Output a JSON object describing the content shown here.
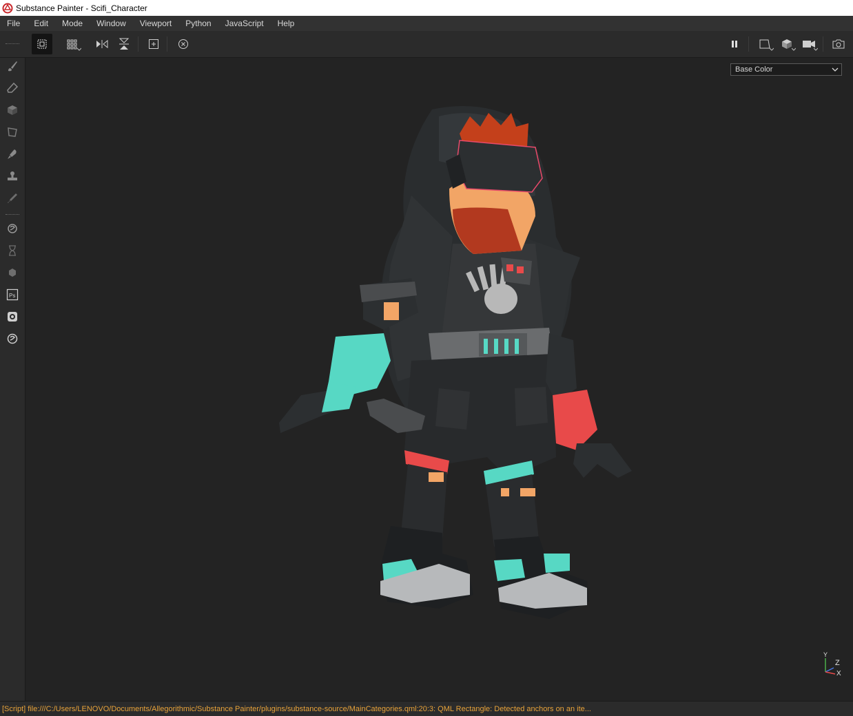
{
  "window": {
    "title": "Substance Painter - Scifi_Character",
    "logo_icon": "substance-painter-logo-icon"
  },
  "menu": {
    "items": [
      "File",
      "Edit",
      "Mode",
      "Window",
      "Viewport",
      "Python",
      "JavaScript",
      "Help"
    ]
  },
  "toolbar": {
    "left_icons": [
      "uv-select-icon",
      "grid-icon",
      "mirror-x-icon",
      "mirror-y-icon",
      "fit-view-icon",
      "reset-camera-icon"
    ],
    "right_icons": [
      "pause-icon",
      "viewport-2d-icon",
      "cube-icon",
      "camera-icon",
      "screenshot-icon"
    ]
  },
  "sidebar": {
    "icons": [
      "paint-brush-icon",
      "eraser-icon",
      "projection-icon",
      "polygon-fill-icon",
      "smudge-icon",
      "clone-stamp-icon",
      "color-picker-icon",
      "bake-icon",
      "history-icon",
      "shelf-icon",
      "photoshop-icon",
      "display-settings-icon",
      "substance-settings-icon"
    ],
    "photoshop_label": "Ps"
  },
  "viewport": {
    "channel_select": {
      "value": "Base Color"
    },
    "gizmo_axes": {
      "y": "Y",
      "z": "Z",
      "x": "X"
    },
    "model": "Scifi_Character"
  },
  "status": {
    "message": "[Script] file:///C:/Users/LENOVO/Documents/Allegorithmic/Substance Painter/plugins/substance-source/MainCategories.qml:20:3: QML Rectangle: Detected anchors on an ite..."
  },
  "colors": {
    "accent_teal": "#57d8c4",
    "accent_red": "#e84a4a",
    "status_orange": "#e8a33a",
    "viewport_bg": "#232323"
  }
}
